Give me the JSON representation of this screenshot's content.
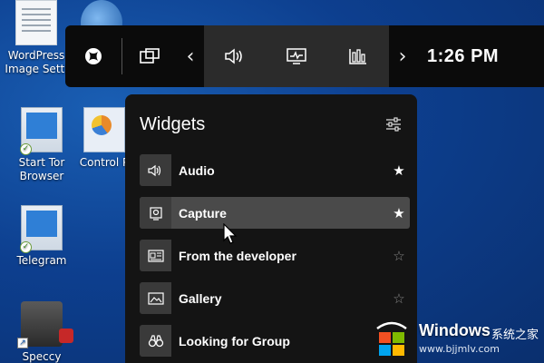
{
  "desktop": {
    "icons": [
      {
        "label": "WordPress Image Setti...",
        "line1": "WordPress",
        "line2": "Image Setti"
      },
      {
        "label": "Start Tor Browser",
        "line1": "Start Tor",
        "line2": "Browser"
      },
      {
        "label": "Control Panel",
        "line1": "Control P",
        "line2": ""
      },
      {
        "label": "Telegram",
        "line1": "Telegram",
        "line2": ""
      },
      {
        "label": "Speccy",
        "line1": "Speccy",
        "line2": ""
      }
    ]
  },
  "gamebar": {
    "buttons": [
      {
        "name": "xbox-icon"
      },
      {
        "name": "capture-widget-icon"
      },
      {
        "name": "chevron-left-icon"
      },
      {
        "name": "audio-icon"
      },
      {
        "name": "performance-icon"
      },
      {
        "name": "resources-icon"
      },
      {
        "name": "chevron-right-icon"
      }
    ],
    "time": "1:26 PM"
  },
  "widgets": {
    "title": "Widgets",
    "settings_icon": "settings-sliders-icon",
    "items": [
      {
        "label": "Audio",
        "icon": "speaker-icon",
        "favorite": true,
        "selected": false
      },
      {
        "label": "Capture",
        "icon": "camera-icon",
        "favorite": true,
        "selected": true
      },
      {
        "label": "From the developer",
        "icon": "news-icon",
        "favorite": false,
        "selected": false
      },
      {
        "label": "Gallery",
        "icon": "gallery-icon",
        "favorite": false,
        "selected": false
      },
      {
        "label": "Looking for Group",
        "icon": "binoculars-icon",
        "favorite": false,
        "selected": false
      }
    ],
    "star_filled": "★",
    "star_empty": "☆"
  },
  "watermark": {
    "brand": "Windows",
    "brand_cn": "系统之家",
    "url": "www.bjjmlv.com"
  },
  "colors": {
    "desktop_bg": "#0d3f8f",
    "bar_bg": "#0b0b0b",
    "bar_mid_bg": "#2b2b2b",
    "panel_bg": "#141414",
    "selected_row": "#4a4a4a"
  }
}
